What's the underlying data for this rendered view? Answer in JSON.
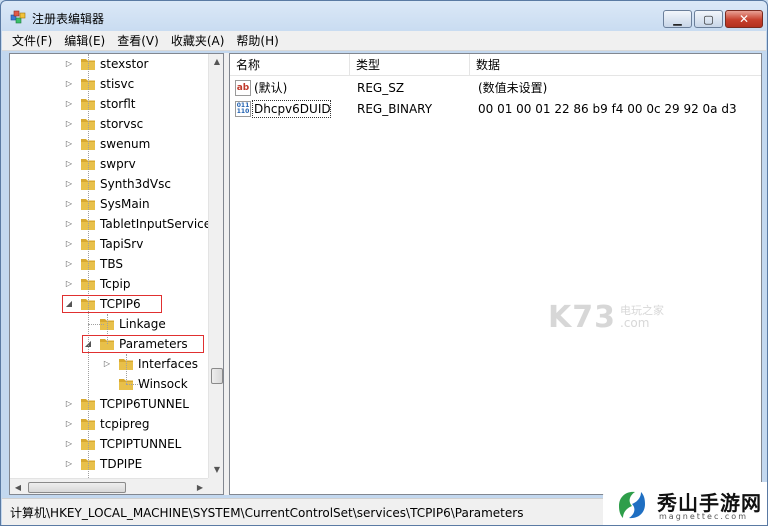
{
  "window": {
    "title": "注册表编辑器",
    "minimize_glyph": "▁",
    "maximize_glyph": "▢",
    "close_glyph": "✕"
  },
  "menu": [
    "文件(F)",
    "编辑(E)",
    "查看(V)",
    "收藏夹(A)",
    "帮助(H)"
  ],
  "tree": {
    "items": [
      {
        "label": "stexstor",
        "expander": "▷",
        "level": 0
      },
      {
        "label": "stisvc",
        "expander": "▷",
        "level": 0
      },
      {
        "label": "storflt",
        "expander": "▷",
        "level": 0
      },
      {
        "label": "storvsc",
        "expander": "▷",
        "level": 0
      },
      {
        "label": "swenum",
        "expander": "▷",
        "level": 0
      },
      {
        "label": "swprv",
        "expander": "▷",
        "level": 0
      },
      {
        "label": "Synth3dVsc",
        "expander": "▷",
        "level": 0
      },
      {
        "label": "SysMain",
        "expander": "▷",
        "level": 0
      },
      {
        "label": "TabletInputService",
        "expander": "▷",
        "level": 0
      },
      {
        "label": "TapiSrv",
        "expander": "▷",
        "level": 0
      },
      {
        "label": "TBS",
        "expander": "▷",
        "level": 0
      },
      {
        "label": "Tcpip",
        "expander": "▷",
        "level": 0
      },
      {
        "label": "TCPIP6",
        "expander": "◢",
        "level": 0
      },
      {
        "label": "Linkage",
        "expander": "",
        "level": 1
      },
      {
        "label": "Parameters",
        "expander": "◢",
        "level": 1
      },
      {
        "label": "Interfaces",
        "expander": "▷",
        "level": 2
      },
      {
        "label": "Winsock",
        "expander": "",
        "level": 2
      },
      {
        "label": "TCPIP6TUNNEL",
        "expander": "▷",
        "level": 0
      },
      {
        "label": "tcpipreg",
        "expander": "▷",
        "level": 0
      },
      {
        "label": "TCPIPTUNNEL",
        "expander": "▷",
        "level": 0
      },
      {
        "label": "TDPIPE",
        "expander": "▷",
        "level": 0
      }
    ]
  },
  "list": {
    "columns": [
      "名称",
      "类型",
      "数据"
    ],
    "rows": [
      {
        "name": "(默认)",
        "type": "REG_SZ",
        "data": "(数值未设置)",
        "icon": "ab",
        "icon_name": "string-value-icon"
      },
      {
        "name": "Dhcpv6DUID",
        "type": "REG_BINARY",
        "data": "00 01 00 01 22 86 b9 f4 00 0c 29 92 0a d3",
        "icon": "011\n110",
        "icon_name": "binary-value-icon"
      }
    ]
  },
  "scroll": {
    "up": "▲",
    "down": "▼",
    "left": "◀",
    "right": "▶"
  },
  "status": {
    "path": "计算机\\HKEY_LOCAL_MACHINE\\SYSTEM\\CurrentControlSet\\services\\TCPIP6\\Parameters"
  },
  "watermark": {
    "brand": "K73",
    "site": "电玩之家",
    "domain": ".com"
  },
  "logo": {
    "name": "秀山手游网",
    "domain": "magnettec.com"
  },
  "colors": {
    "highlight_box": "#e03030",
    "folder": "#e8c04a",
    "selection": "#ffffff"
  }
}
